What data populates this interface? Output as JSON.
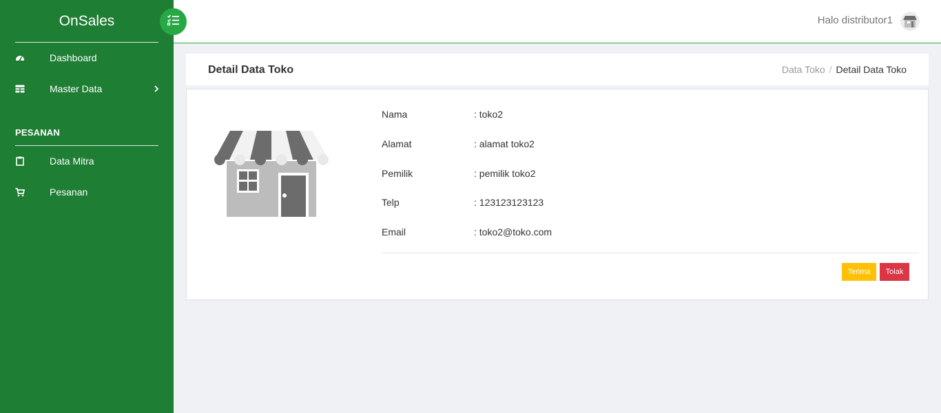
{
  "sidebar": {
    "brand": "OnSales",
    "items": [
      {
        "label": "Dashboard",
        "icon": "dashboard-gauge-icon"
      },
      {
        "label": "Master Data",
        "icon": "table-icon"
      }
    ],
    "section_heading": "PESANAN",
    "section_items": [
      {
        "label": "Data Mitra",
        "icon": "clipboard-icon"
      },
      {
        "label": "Pesanan",
        "icon": "cart-icon"
      }
    ]
  },
  "topbar": {
    "greeting": "Halo distributor1",
    "avatar_icon": "store-avatar-icon",
    "menu_toggle_icon": "list-check-icon"
  },
  "page": {
    "title": "Detail Data Toko",
    "breadcrumb": {
      "parent": "Data Toko",
      "separator": "/",
      "current": "Detail Data Toko"
    }
  },
  "detail": {
    "image_icon": "store-front-icon",
    "fields": [
      {
        "label": "Nama",
        "value": ": toko2"
      },
      {
        "label": "Alamat",
        "value": ": alamat toko2"
      },
      {
        "label": "Pemilik",
        "value": ": pemilik toko2"
      },
      {
        "label": "Telp",
        "value": ": 123123123123"
      },
      {
        "label": "Email",
        "value": ": toko2@toko.com"
      }
    ]
  },
  "actions": {
    "accept": "Terima",
    "reject": "Tolak"
  },
  "colors": {
    "sidebar": "#1e7e34",
    "toggle": "#28a745",
    "accept": "#ffc107",
    "reject": "#dc3545",
    "background": "#f0f1f5"
  }
}
